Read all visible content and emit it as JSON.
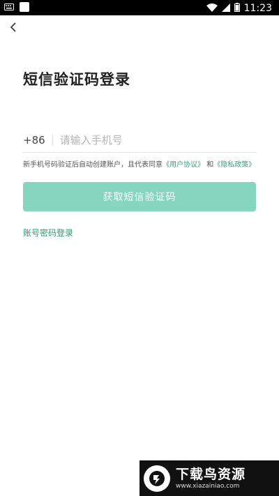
{
  "status_bar": {
    "time": "11:23"
  },
  "page": {
    "title": "短信验证码登录"
  },
  "phone": {
    "country_code": "+86",
    "placeholder": "请输入手机号"
  },
  "agreement": {
    "prefix": "新手机号码验证后自动创建账户，且代表同意",
    "user_agreement": "《用户协议》",
    "and": "和",
    "privacy_policy": "《隐私政策》"
  },
  "buttons": {
    "get_code": "获取短信验证码"
  },
  "links": {
    "password_login": "账号密码登录"
  },
  "watermark": {
    "name": "下载鸟资源",
    "url": "www.xiazainiao.com"
  },
  "colors": {
    "accent": "#86d5bf",
    "link": "#2e9a6d",
    "status_bar": "#000000"
  }
}
